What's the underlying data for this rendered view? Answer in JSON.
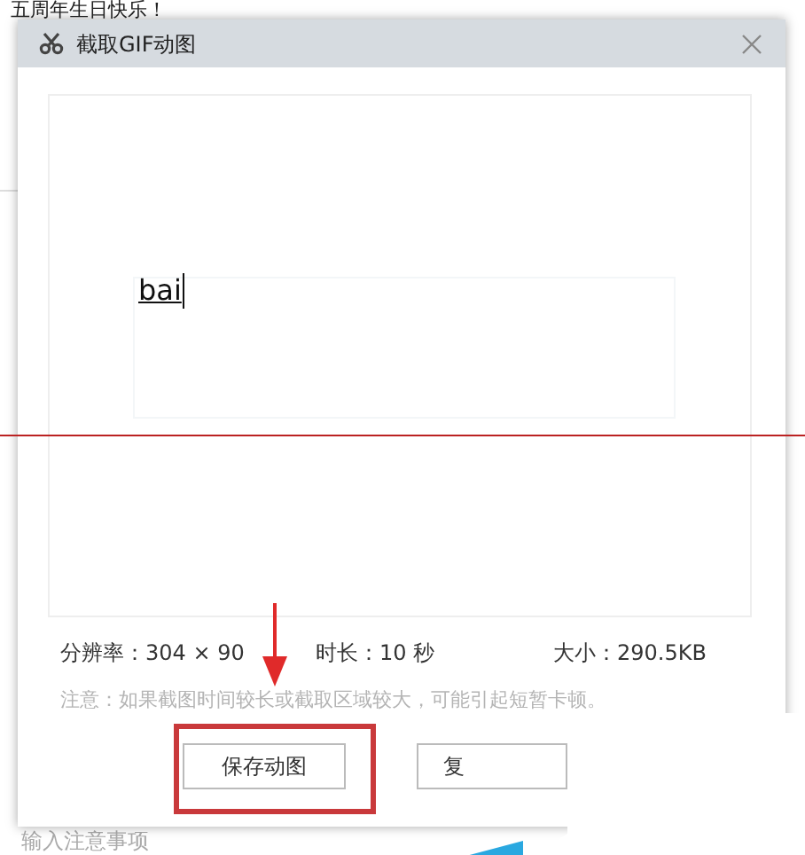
{
  "background": {
    "heading": "五周年生日快乐！",
    "footer_hint": "输入注意事项"
  },
  "dialog": {
    "title": "截取GIF动图",
    "preview_text": "bai",
    "info": [
      "分辨率：304 × 90",
      "时长：10 秒",
      "大小：290.5KB"
    ],
    "note": "注意：如果截图时间较长或截取区域较大，可能引起短暂卡顿。",
    "buttons": [
      "保存动图",
      "复"
    ]
  },
  "annotations": [
    {
      "kind": "line"
    },
    {
      "kind": "box"
    },
    {
      "kind": "arrow"
    }
  ]
}
